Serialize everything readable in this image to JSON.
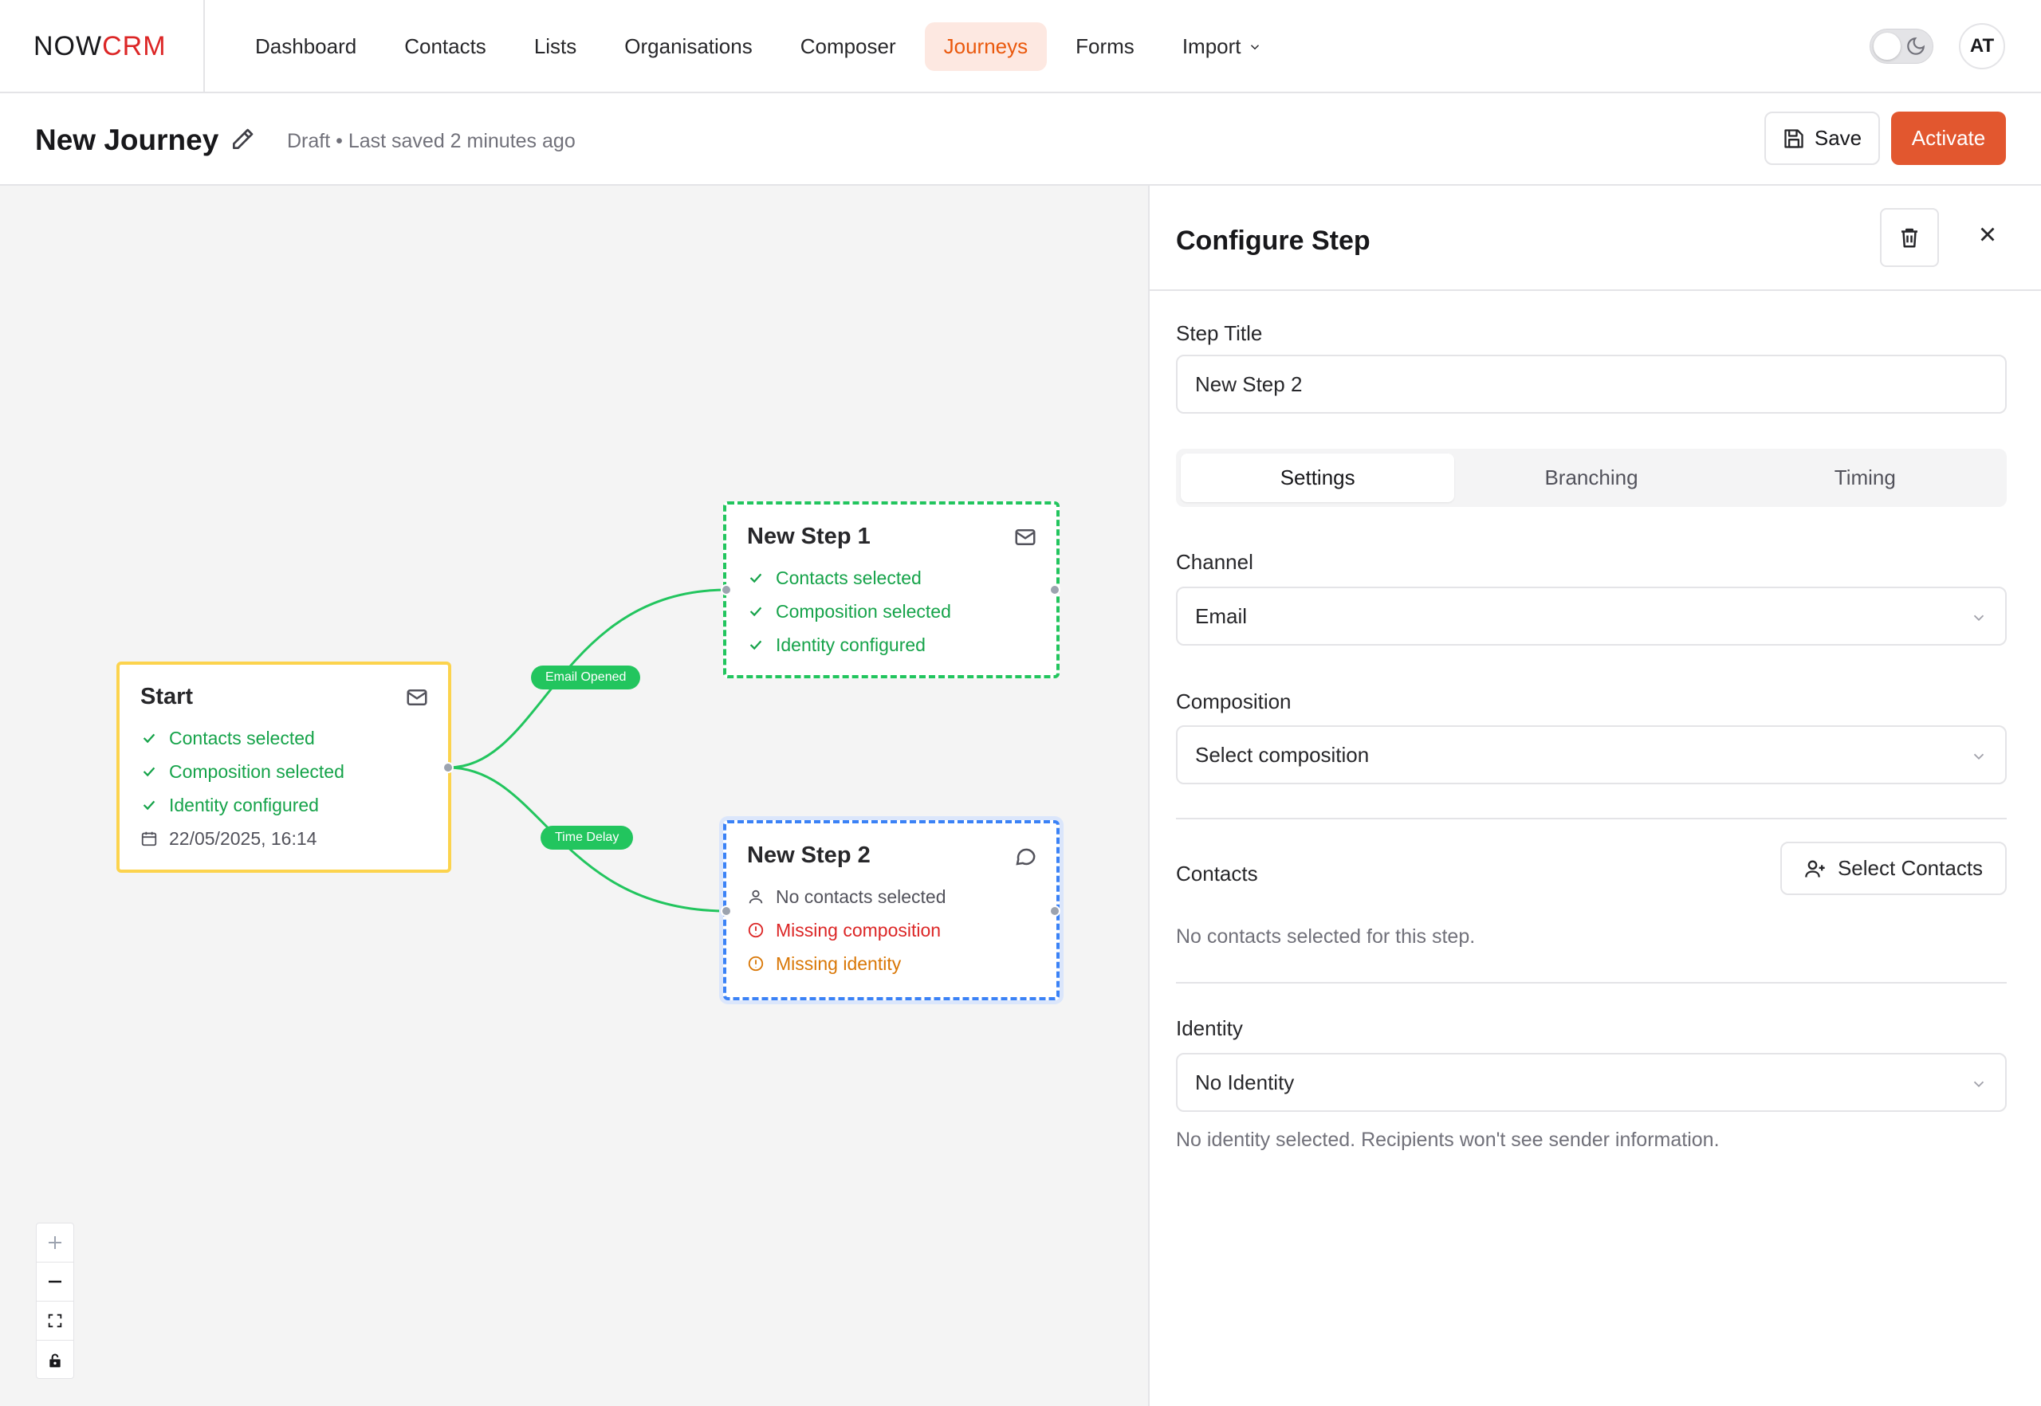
{
  "brand": {
    "part1": "NOW",
    "part2": "CRM",
    "accent": "#dc2626"
  },
  "nav": {
    "items": [
      {
        "label": "Dashboard"
      },
      {
        "label": "Contacts"
      },
      {
        "label": "Lists"
      },
      {
        "label": "Organisations"
      },
      {
        "label": "Composer"
      },
      {
        "label": "Journeys",
        "active": true
      },
      {
        "label": "Forms"
      },
      {
        "label": "Import",
        "dropdown": true
      }
    ],
    "user_initials": "AT"
  },
  "journey": {
    "title": "New Journey",
    "status": "Draft • Last saved 2 minutes ago",
    "save_label": "Save",
    "activate_label": "Activate"
  },
  "nodes": {
    "start": {
      "title": "Start",
      "icon": "mail-icon",
      "items": [
        "Contacts selected",
        "Composition selected",
        "Identity configured"
      ],
      "date": "22/05/2025, 16:14"
    },
    "step1": {
      "title": "New Step 1",
      "icon": "mail-icon",
      "items": [
        "Contacts selected",
        "Composition selected",
        "Identity configured"
      ]
    },
    "step2": {
      "title": "New Step 2",
      "icon": "message-icon",
      "contacts": "No contacts selected",
      "composition": "Missing composition",
      "identity": "Missing identity"
    }
  },
  "edges": {
    "email_opened": "Email Opened",
    "time_delay": "Time Delay"
  },
  "panel": {
    "title": "Configure Step",
    "step_title_label": "Step Title",
    "step_title_value": "New Step 2",
    "tabs": [
      "Settings",
      "Branching",
      "Timing"
    ],
    "channel_label": "Channel",
    "channel_value": "Email",
    "composition_label": "Composition",
    "composition_value": "Select composition",
    "contacts_label": "Contacts",
    "select_contacts_label": "Select Contacts",
    "contacts_help": "No contacts selected for this step.",
    "identity_label": "Identity",
    "identity_value": "No Identity",
    "identity_help": "No identity selected. Recipients won't see sender information."
  }
}
